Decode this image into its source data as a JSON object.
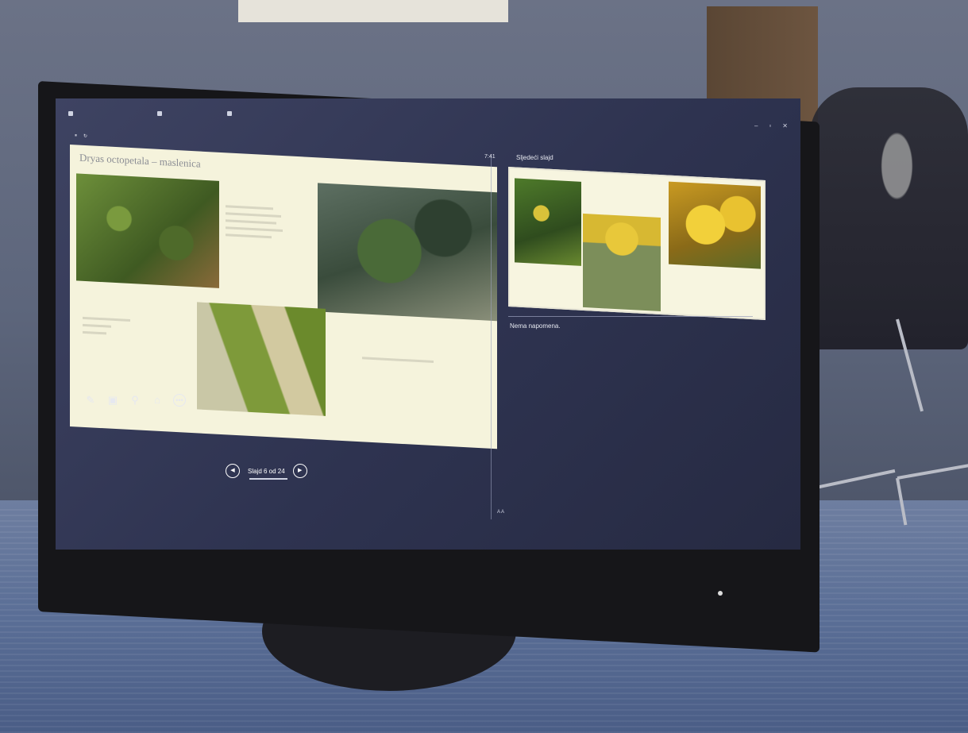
{
  "presenter": {
    "topbar": [
      "",
      "",
      ""
    ],
    "timer": "",
    "clock": "7:41",
    "slide_title": "Dryas octopetala – maslenica",
    "next_slide_label": "Sljedeći slajd",
    "notes": "Nema napomena.",
    "nav_counter": "Slajd 6 od 24",
    "font_controls": "A  A"
  },
  "monitor": {
    "brand": "hp"
  },
  "colors": {
    "screen_bg": "#2e3350",
    "slide_bg": "#f5f3dc",
    "accent_yellow": "#e9c230"
  },
  "icons": [
    "pen-icon",
    "laser-pointer-icon",
    "zoom-icon",
    "display-settings-icon",
    "more-options-icon",
    "prev-icon",
    "next-icon"
  ]
}
